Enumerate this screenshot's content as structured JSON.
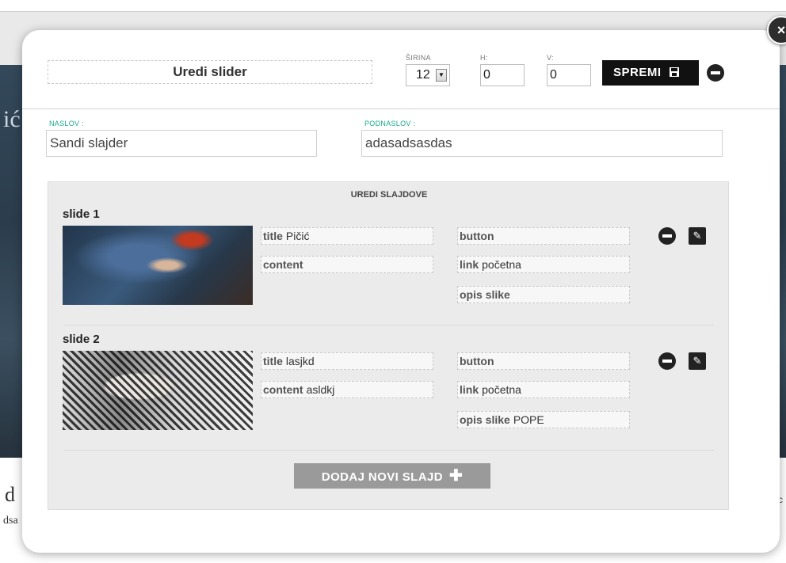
{
  "background": {
    "letter_hero": "ić",
    "letter_lower": "d",
    "letter_small": "dsa",
    "letter_right": "c"
  },
  "modal": {
    "close_icon": "×",
    "title": "Uredi slider",
    "sirina_label": "ŠIRINA",
    "sirina_value": "12",
    "h_label": "H:",
    "h_value": "0",
    "v_label": "V:",
    "v_value": "0",
    "save_label": "SPREMI",
    "naslov_label": "NASLOV :",
    "naslov_value": "Sandi slajder",
    "podnaslov_label": "PODNASLOV :",
    "podnaslov_value": "adasadsasdas"
  },
  "slides_panel": {
    "title": "UREDI SLAJDOVE",
    "add_label": "DODAJ NOVI SLAJD",
    "slides": [
      {
        "name": "slide 1",
        "title_label": "title",
        "title_value": "Pičić",
        "content_label": "content",
        "content_value": "",
        "button_label": "button",
        "button_value": "",
        "link_label": "link",
        "link_value": "početna",
        "opis_label": "opis slike",
        "opis_value": ""
      },
      {
        "name": "slide 2",
        "title_label": "title",
        "title_value": "lasjkd",
        "content_label": "content",
        "content_value": "asldkj",
        "button_label": "button",
        "button_value": "",
        "link_label": "link",
        "link_value": "početna",
        "opis_label": "opis slike",
        "opis_value": "POPE"
      }
    ]
  },
  "icons": {
    "remove": "minus-circle-icon",
    "edit": "pencil-icon",
    "save": "floppy-icon",
    "add": "plus-icon",
    "dropdown": "dropdown-arrow-icon"
  }
}
